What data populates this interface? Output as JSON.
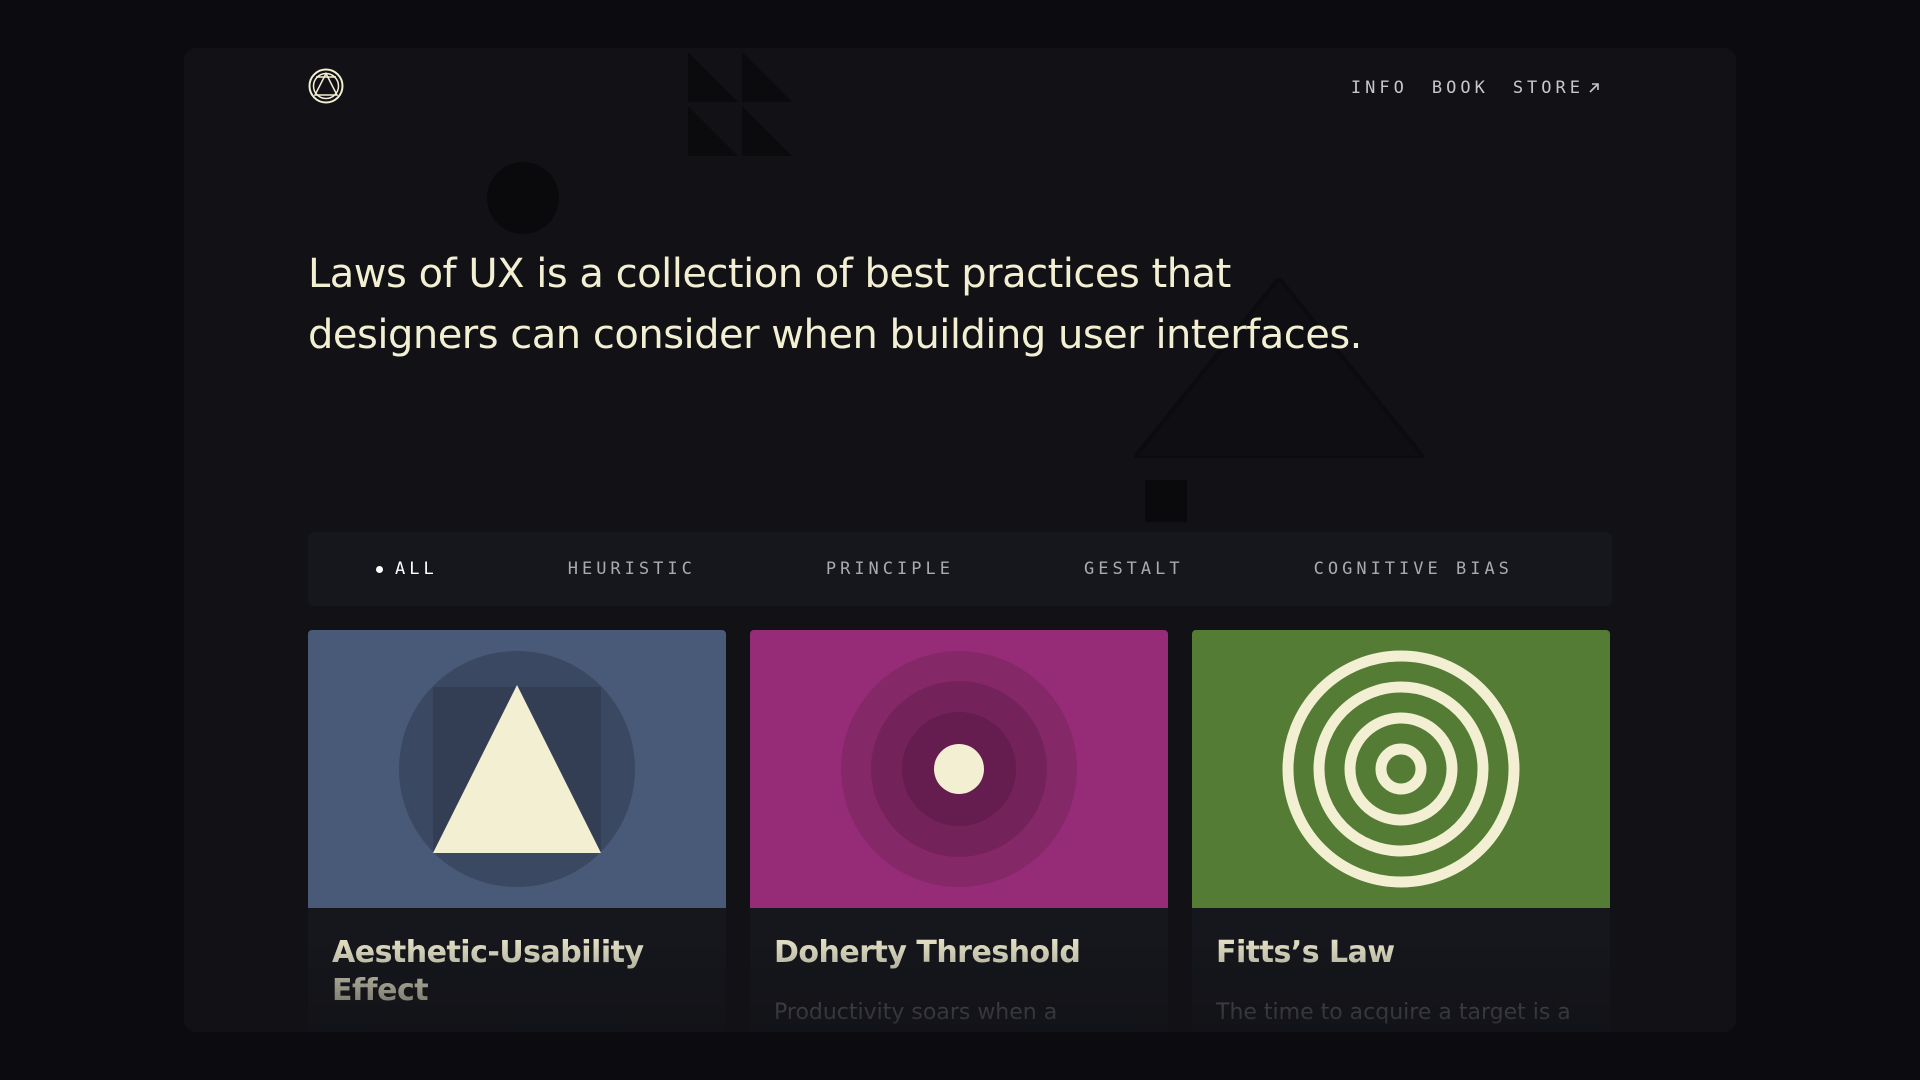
{
  "nav": {
    "items": [
      {
        "label": "INFO"
      },
      {
        "label": "BOOK"
      },
      {
        "label": "STORE",
        "icon": "arrow-up-right-icon"
      }
    ]
  },
  "logo": {
    "icon": "logo-icon"
  },
  "hero": {
    "text": "Laws of UX is a collection of best practices that designers can consider when building user interfaces."
  },
  "filters": [
    {
      "label": "ALL",
      "active": true
    },
    {
      "label": "HEURISTIC"
    },
    {
      "label": "PRINCIPLE"
    },
    {
      "label": "GESTALT"
    },
    {
      "label": "COGNITIVE BIAS"
    }
  ],
  "cards": [
    {
      "title": "Aesthetic-Usability Effect",
      "desc": "",
      "color": "#485a78",
      "icon": "triangle-in-circle-icon"
    },
    {
      "title": "Doherty Threshold",
      "desc": "Productivity soars when a",
      "color": "#962c78",
      "icon": "concentric-dot-icon"
    },
    {
      "title": "Fitts’s Law",
      "desc": "The time to acquire a target is a",
      "color": "#547c35",
      "icon": "target-rings-icon"
    }
  ],
  "colors": {
    "background": "#0b0b10",
    "panel": "#111116",
    "cream": "#f2efd2"
  }
}
